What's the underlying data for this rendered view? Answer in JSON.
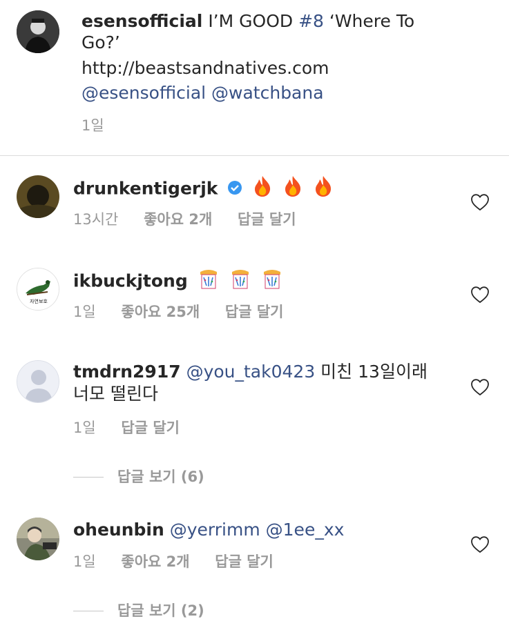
{
  "post": {
    "username": "esensofficial",
    "text_line1": "I’M GOOD ",
    "hashtag": "#8",
    "text_line1_end": " ‘Where To",
    "text_line2": "Go?’",
    "link": "http://beastsandnatives.com",
    "mention1": "@esensofficial",
    "mention2": "@watchbana",
    "time": "1일"
  },
  "comments": [
    {
      "username": "drunkentigerjk",
      "verified": true,
      "emoji_icon": "fire-icon",
      "time": "13시간",
      "likes": "좋아요 2개",
      "reply": "답글 달기"
    },
    {
      "username": "ikbuckjtong",
      "emoji_icon": "party-popper-icon",
      "avatar_text": "자연보호",
      "time": "1일",
      "likes": "좋아요 25개",
      "reply": "답글 달기"
    },
    {
      "username": "tmdrn2917",
      "mention": "@you_tak0423",
      "text_line1": " 미친 13일이래",
      "text_line2": "너모 떨린다",
      "time": "1일",
      "reply": "답글 달기",
      "view_replies": "답글 보기 (6)"
    },
    {
      "username": "oheunbin",
      "mention1": "@yerrimm",
      "mention2": "@1ee_xx",
      "time": "1일",
      "likes": "좋아요 2개",
      "reply": "답글 달기",
      "view_replies": "답글 보기 (2)"
    }
  ],
  "colors": {
    "link_blue": "#385185",
    "meta_gray": "#999999",
    "verified_blue": "#3897f0"
  }
}
